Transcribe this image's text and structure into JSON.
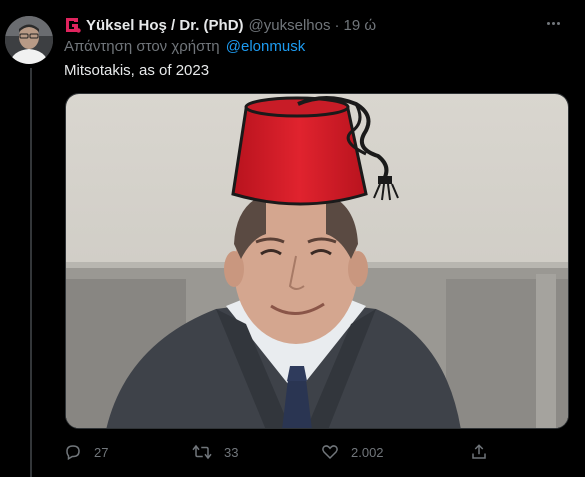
{
  "tweet": {
    "display_name": "Yüksel Hoş / Dr. (PhD)",
    "handle": "@yukselhos",
    "separator": "·",
    "time": "19 ώ",
    "reply_prefix": "Απάντηση στον χρήστη",
    "reply_mention": "@elonmusk",
    "text": "Mitsotakis, as of 2023",
    "image_alt": "Photo of Mitsotakis with a drawn red fez hat"
  },
  "actions": {
    "reply": {
      "icon": "reply-icon",
      "count": "27"
    },
    "retweet": {
      "icon": "retweet-icon",
      "count": "33"
    },
    "like": {
      "icon": "heart-icon",
      "count": "2.002"
    },
    "share": {
      "icon": "share-icon"
    }
  },
  "colors": {
    "background": "#000000",
    "primary_text": "#e7e9ea",
    "secondary_text": "#71767b",
    "link": "#1d9bf0",
    "brand_icon": "#e0245e",
    "fez": "#e0232e"
  }
}
